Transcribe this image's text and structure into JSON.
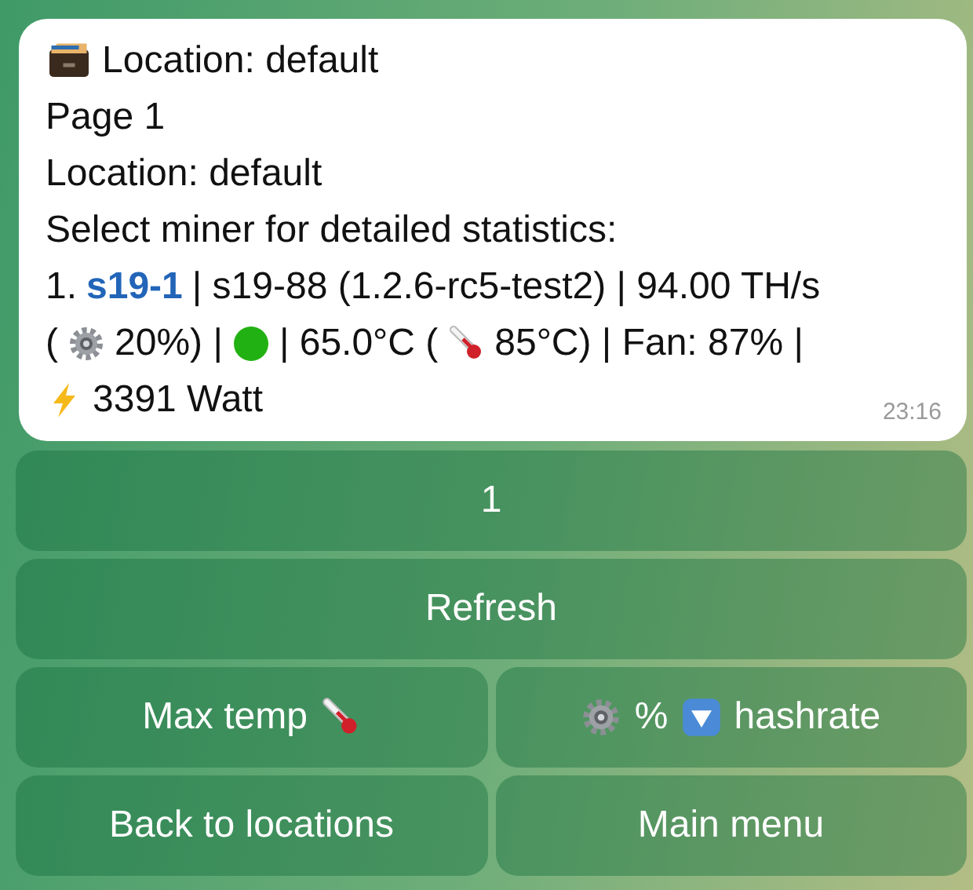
{
  "message": {
    "lines": [
      [
        {
          "kind": "cabinet"
        },
        {
          "kind": "text",
          "text": "Location: default"
        }
      ],
      [
        {
          "kind": "text",
          "text": "Page 1"
        }
      ],
      [
        {
          "kind": "text",
          "text": "Location: default"
        }
      ],
      [
        {
          "kind": "text",
          "text": "Select miner for detailed statistics:"
        }
      ],
      [
        {
          "kind": "text",
          "text": "1."
        },
        {
          "kind": "link",
          "text": "s19-1"
        },
        {
          "kind": "text",
          "text": "| s19-88 (1.2.6-rc5-test2) | 94.00 TH/s"
        }
      ],
      [
        {
          "kind": "text",
          "text": "("
        },
        {
          "kind": "gear"
        },
        {
          "kind": "text",
          "text": "20%) |"
        },
        {
          "kind": "status",
          "color": "#22b112"
        },
        {
          "kind": "text",
          "text": "| 65.0°C ("
        },
        {
          "kind": "thermometer"
        },
        {
          "kind": "text",
          "text": "85°C) | Fan: 87% |"
        }
      ],
      [
        {
          "kind": "bolt"
        },
        {
          "kind": "text",
          "text": "3391 Watt"
        }
      ]
    ],
    "time": "23:16"
  },
  "keyboard": [
    [
      {
        "parts": [
          {
            "kind": "text",
            "text": "1"
          }
        ]
      }
    ],
    [
      {
        "parts": [
          {
            "kind": "text",
            "text": "Refresh"
          }
        ]
      }
    ],
    [
      {
        "parts": [
          {
            "kind": "text",
            "text": "Max temp"
          },
          {
            "kind": "thermometer"
          }
        ]
      },
      {
        "parts": [
          {
            "kind": "gear"
          },
          {
            "kind": "text",
            "text": "%"
          },
          {
            "kind": "down"
          },
          {
            "kind": "text",
            "text": "hashrate"
          }
        ]
      }
    ],
    [
      {
        "parts": [
          {
            "kind": "text",
            "text": "Back to locations"
          }
        ]
      },
      {
        "parts": [
          {
            "kind": "text",
            "text": "Main menu"
          }
        ]
      }
    ]
  ]
}
